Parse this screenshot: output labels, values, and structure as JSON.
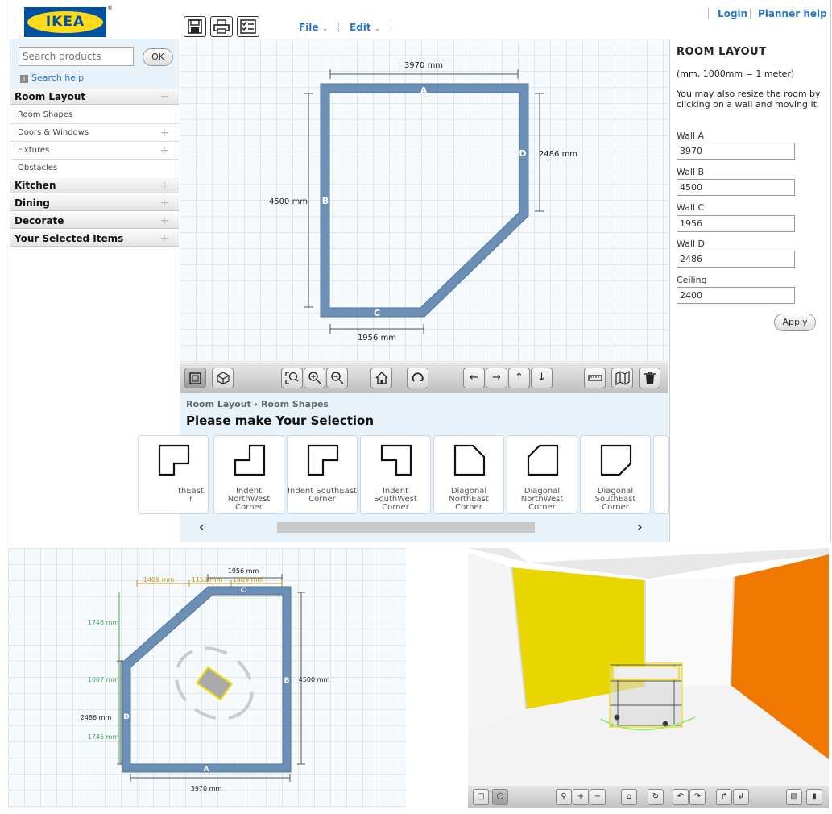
{
  "header": {
    "brand": "IKEA",
    "registered_mark": "®",
    "menu": [
      {
        "label": "File"
      },
      {
        "label": "Edit"
      }
    ],
    "links": {
      "login": "Login",
      "planner_help": "Planner help"
    },
    "toolbar_icons": [
      "save-icon",
      "print-icon",
      "checklist-icon"
    ]
  },
  "sidebar": {
    "search": {
      "placeholder": "Search products",
      "ok_label": "OK",
      "help_label": "Search help"
    },
    "room_layout": {
      "label": "Room Layout",
      "toggle": "−"
    },
    "room_layout_items": [
      {
        "label": "Room Shapes",
        "toggle": ""
      },
      {
        "label": "Doors & Windows",
        "toggle": "+"
      },
      {
        "label": "Fixtures",
        "toggle": "+"
      },
      {
        "label": "Obstacles",
        "toggle": ""
      }
    ],
    "categories": [
      {
        "label": "Kitchen",
        "toggle": "+"
      },
      {
        "label": "Dining",
        "toggle": "+"
      },
      {
        "label": "Decorate",
        "toggle": "+"
      },
      {
        "label": "Your Selected Items",
        "toggle": "+"
      }
    ]
  },
  "plan": {
    "wall_letters": {
      "a": "A",
      "b": "B",
      "c": "C",
      "d": "D"
    },
    "dims": {
      "a": "3970 mm",
      "b": "4500 mm",
      "c": "1956 mm",
      "d": "2486 mm"
    }
  },
  "room_layout_panel": {
    "title": "ROOM LAYOUT",
    "units_note": "(mm, 1000mm = 1 meter)",
    "instructions": "You may also resize the room by clicking on a wall and moving it.",
    "fields": [
      {
        "label": "Wall A",
        "value": "3970"
      },
      {
        "label": "Wall B",
        "value": "4500"
      },
      {
        "label": "Wall C",
        "value": "1956"
      },
      {
        "label": "Wall D",
        "value": "2486"
      },
      {
        "label": "Ceiling",
        "value": "2400"
      }
    ],
    "apply_label": "Apply"
  },
  "toolbar_main": {
    "icons": [
      "2d-view-icon",
      "3d-view-icon",
      "zoom-fit-icon",
      "zoom-in-icon",
      "zoom-out-icon",
      "home-icon",
      "rotate-icon",
      "arrow-left-icon",
      "arrow-right-icon",
      "arrow-up-icon",
      "arrow-down-icon",
      "ruler-icon",
      "floorplan-icon",
      "trash-icon"
    ]
  },
  "selection": {
    "breadcrumb": [
      "Room Layout",
      "Room Shapes"
    ],
    "breadcrumb_sep": "›",
    "title": "Please make Your Selection",
    "shapes": [
      {
        "label": "thEast\nr"
      },
      {
        "label": "Indent\nNorthWest\nCorner"
      },
      {
        "label": "Indent SouthEast\nCorner"
      },
      {
        "label": "Indent\nSouthWest\nCorner"
      },
      {
        "label": "Diagonal\nNorthEast Corner"
      },
      {
        "label": "Diagonal\nNorthWest\nCorner"
      },
      {
        "label": "Diagonal\nSouthEast Corner"
      }
    ],
    "scroll_left": "‹",
    "scroll_right": "›"
  },
  "plan2": {
    "dims": {
      "top_c": "1956 mm",
      "top_seg1": "1409 mm",
      "top_seg2": "1153 mm",
      "top_seg3": "1409 mm",
      "left_upper": "1746 mm",
      "left_mid": "1007 mm",
      "left_d": "2486 mm",
      "left_lower": "1746 mm",
      "right_b": "4500 mm",
      "bottom_a": "3970 mm"
    },
    "wall_letters": {
      "a": "A",
      "b": "B",
      "c": "C",
      "d": "D"
    }
  },
  "view3d": {
    "colors": {
      "left_wall": "#e8d600",
      "right_wall": "#f07a00",
      "back_wall": "#ffffff",
      "floor": "#f2f2f2"
    },
    "toolbar_icons": [
      "2d-view-icon",
      "3d-view-icon",
      "zoom-fit-icon",
      "zoom-in-icon",
      "zoom-out-icon",
      "home-icon",
      "rotate-icon",
      "pan-left-icon",
      "pan-right-icon",
      "tilt-up-icon",
      "tilt-down-icon",
      "floorplan-icon",
      "trash-icon"
    ]
  }
}
